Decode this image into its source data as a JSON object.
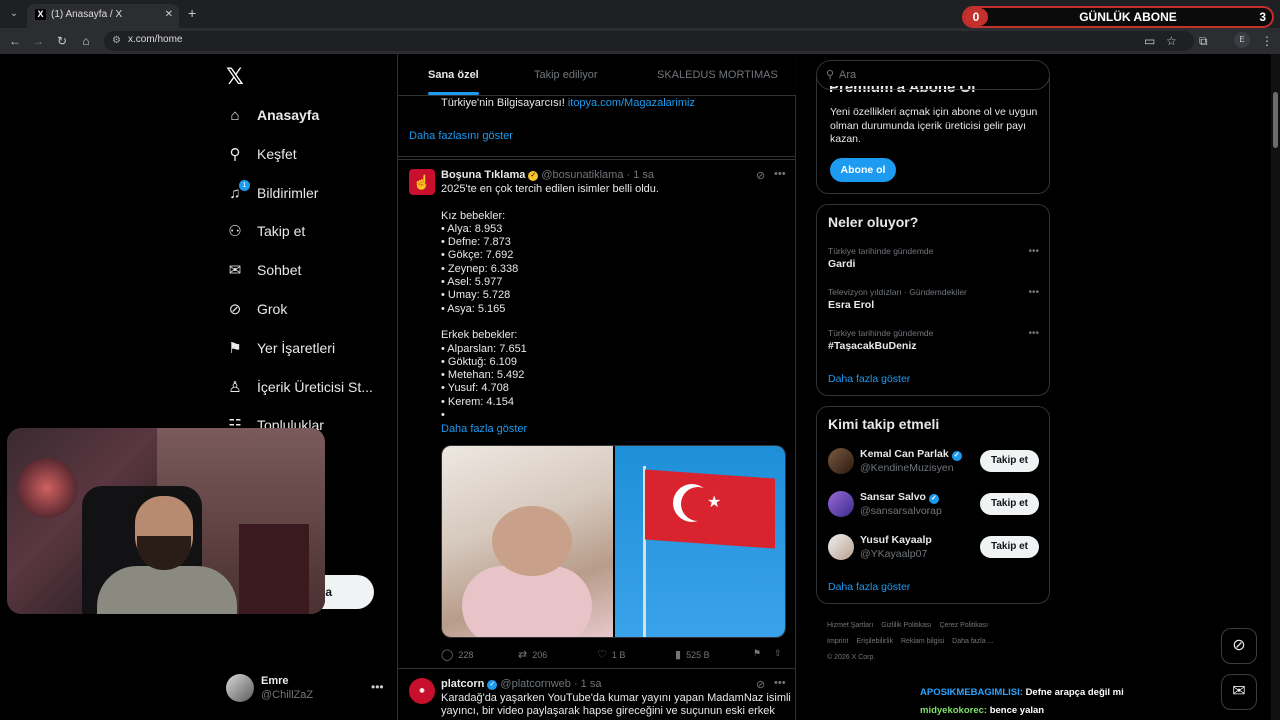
{
  "browser": {
    "tab_title": "(1) Anasayfa / X",
    "tab_favicon": "X",
    "url": "x.com/home",
    "profile_letter": "E"
  },
  "stream_overlay": {
    "subs_left": "0",
    "subs_title": "GÜNLÜK ABONE",
    "subs_right": "3"
  },
  "sidebar": {
    "logo": "𝕏",
    "notifications_badge": "1",
    "items": [
      {
        "label": "Anasayfa",
        "icon": "home-icon"
      },
      {
        "label": "Keşfet",
        "icon": "search-icon"
      },
      {
        "label": "Bildirimler",
        "icon": "bell-icon"
      },
      {
        "label": "Takip et",
        "icon": "follow-icon"
      },
      {
        "label": "Sohbet",
        "icon": "mail-icon"
      },
      {
        "label": "Grok",
        "icon": "grok-icon"
      },
      {
        "label": "Yer İşaretleri",
        "icon": "bookmark-icon"
      },
      {
        "label": "İçerik Üreticisi St...",
        "icon": "flask-icon"
      },
      {
        "label": "Topluluklar",
        "icon": "communities-icon"
      }
    ],
    "post_button_fragment": "la",
    "account": {
      "name": "Emre",
      "handle": "@ChillZaZ"
    }
  },
  "feed": {
    "tabs": [
      "Sana özel",
      "Takip ediliyor",
      "SKALEDUS MORTIMAS"
    ],
    "prev_post_tail": "Türkiye'nin Bilgisayarcısı! ",
    "prev_post_link": "itopya.com/Magazalarimiz",
    "prev_show_more": "Daha fazlasını göster",
    "post1": {
      "name": "Boşuna Tıklama",
      "handle": "@bosunatiklama",
      "time": "· 1 sa",
      "text": "2025'te en çok tercih edilen isimler belli oldu.\n\nKız bebekler:\n• Alya: 8.953\n• Defne: 7.873\n• Gökçe: 7.692\n• Zeynep: 6.338\n• Asel: 5.977\n• Umay: 5.728\n• Asya: 5.165\n\nErkek bebekler:\n• Alparslan: 7.651\n• Göktuğ: 6.109\n• Metehan: 5.492\n• Yusuf: 4.708\n• Kerem: 4.154\n•",
      "show_more": "Daha fazla göster",
      "replies": "228",
      "reposts": "206",
      "likes": "1 B",
      "views": "525 B"
    },
    "post2": {
      "name": "platcorn",
      "handle": "@platcornweb",
      "time": "· 1 sa",
      "text": "Karadağ'da yaşarken YouTube'da kumar yayını yapan MadamNaz isimli\nyayıncı, bir video paylaşarak hapse gireceğini ve suçunun eski erkek"
    }
  },
  "right": {
    "search_placeholder": "Ara",
    "premium": {
      "title": "Premium'a Abone Ol",
      "desc": "Yeni özellikleri açmak için abone ol ve uygun olman durumunda içerik üreticisi gelir payı kazan.",
      "button": "Abone ol"
    },
    "trends": {
      "title": "Neler oluyor?",
      "items": [
        {
          "context": "Türkiye tarihinde gündemde",
          "name": "Gardi"
        },
        {
          "context": "Televizyon yıldızları · Gündemdekiler",
          "name": "Esra Erol"
        },
        {
          "context": "Türkiye tarihinde gündemde",
          "name": "#TaşacakBuDeniz"
        }
      ],
      "show_more": "Daha fazla göster"
    },
    "who_to_follow": {
      "title": "Kimi takip etmeli",
      "items": [
        {
          "name": "Kemal Can Parlak",
          "handle": "@KendineMuzisyen",
          "button": "Takip et"
        },
        {
          "name": "Sansar Salvo",
          "handle": "@sansarsalvorap",
          "button": "Takip et"
        },
        {
          "name": "Yusuf Kayaalp",
          "handle": "@YKayaalp07",
          "button": "Takip et"
        }
      ],
      "show_more": "Daha fazla göster"
    },
    "footer": [
      "Hizmet Şartları",
      "Gizlilik Politikası",
      "Çerez Politikası",
      "Imprint",
      "Erişilebilirlik",
      "Reklam bilgisi",
      "Daha fazla ...",
      "© 2026 X Corp."
    ]
  },
  "chat": [
    {
      "user": "APOSIKMEBAGIMLISI:",
      "msg": "Defne arapça değil mi"
    },
    {
      "user": "midyekokorec:",
      "msg": "bence yalan"
    }
  ],
  "colors": {
    "accent": "#1d9bf0",
    "overlay_red": "#c4302b"
  }
}
